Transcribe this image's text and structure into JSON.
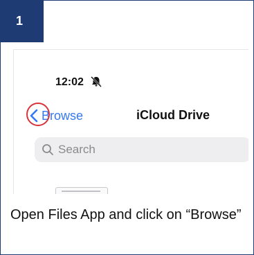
{
  "step": {
    "number": "1"
  },
  "phone": {
    "status_time": "12:02",
    "nav": {
      "back_label": "Browse",
      "title": "iCloud Drive"
    },
    "search": {
      "placeholder": "Search"
    }
  },
  "caption": {
    "text": "Open Files App and click on “Browse”"
  },
  "colors": {
    "badge": "#1f3b73",
    "link": "#3478f6",
    "highlight": "#d8333a",
    "search_bg": "#eeeef0"
  },
  "icons": {
    "bell": "bell-slash-icon",
    "back": "chevron-left-icon",
    "search": "magnifier-icon"
  }
}
